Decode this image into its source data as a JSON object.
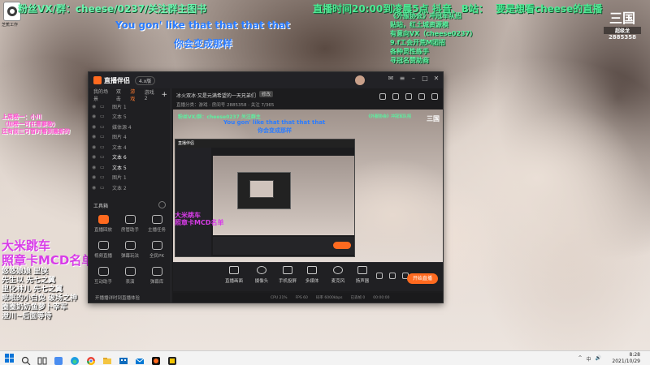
{
  "ticker": {
    "part1": "粉丝VX/群：cheese/0237/关注群主图书",
    "part2": "直播时间20:00到凌晨5点 抖音、B站：",
    "part3": "要是想看cheese的直播"
  },
  "app_badge": {
    "label": "芝蕉工作"
  },
  "lyrics": {
    "line1": "You gon' like that that that that",
    "line2": "你会变成那样"
  },
  "notice": [
    "《外服协会》冲冠军队招",
    "贴站，红土城资源模",
    "有意向VX（cheese0237）",
    "9.f工会开荒M团招",
    "各种灵性练手",
    "寻冠名赞助商"
  ],
  "brand_logo": {
    "big": "三国",
    "small": "超级龙",
    "number": "2885358"
  },
  "left_note": [
    "上周榜一：小川",
    "（加榜一可任意要歌）",
    "还有前三可暂时看到最新的"
  ],
  "big_title": [
    "大米跳车",
    "照章卡MCD名单"
  ],
  "gift_list": [
    "悠悠娘娘 里侠",
    "先生以 先七之翼",
    "里化林儿 先七之翼",
    "眠眠的小白兔 破场之神",
    "圈圈奶奶鱼萝卜宰军",
    "澄川~后面等待"
  ],
  "window": {
    "app_name": "直播伴侣",
    "version": "4.x版",
    "scene_tabs": [
      "我的场景",
      "双击",
      "游戏",
      "游戏2"
    ],
    "active_tab": "游戏",
    "sources": [
      {
        "label": "图片 1",
        "on": false
      },
      {
        "label": "文本 5",
        "on": false
      },
      {
        "label": "媒体源 4",
        "on": false
      },
      {
        "label": "图片 4",
        "on": false
      },
      {
        "label": "文本 4",
        "on": false
      },
      {
        "label": "文本 6",
        "on": true
      },
      {
        "label": "文本 5",
        "on": true
      },
      {
        "label": "图片 1",
        "on": false
      },
      {
        "label": "文本 2",
        "on": false
      }
    ],
    "tools_label": "工具箱",
    "tools": [
      {
        "label": "直播回放",
        "hot": true
      },
      {
        "label": "房管助手",
        "hot": false
      },
      {
        "label": "主播任务",
        "hot": false
      },
      {
        "label": "视频直播",
        "hot": false
      },
      {
        "label": "弹幕玩法",
        "hot": false
      },
      {
        "label": "全民PK",
        "hot": false
      },
      {
        "label": "互动助手",
        "hot": false
      },
      {
        "label": "表演",
        "hot": false
      },
      {
        "label": "弹幕库",
        "hot": false
      }
    ],
    "sidebar_bottom": "开播播详时到直播体验",
    "room_title": "冰火双冰·又是元满希望的一天兄弟们",
    "room_tag": "修改",
    "room_sub": "直播分类：游戏 · 房间号 2885358 · 关注 7/365",
    "controls": [
      {
        "label": "直播画面"
      },
      {
        "label": "摄像头"
      },
      {
        "label": "手机投屏"
      },
      {
        "label": "多媒体"
      },
      {
        "label": "麦克风"
      },
      {
        "label": "扬声器"
      }
    ],
    "start_label": "开始直播",
    "status": [
      "CPU 21%",
      "FPS 60",
      "码率 6000kbps",
      "已丢帧 0",
      "00:00:00"
    ]
  },
  "preview": {
    "ticker": "粉丝VX/群：cheese0237 关注群主",
    "lyric1": "You gon' like that that that that",
    "lyric2": "你会变成那样",
    "notice": "《外服协会》冲冠军队招",
    "logo": "三国",
    "big": "大米跳车\n照章卡MCD名单",
    "nested_title": "直播伴侣"
  },
  "taskbar": {
    "time": "8:28",
    "date": "2021/10/29",
    "tray": [
      "^",
      "中",
      "🔊"
    ]
  },
  "colors": {
    "accent": "#ff6a1f",
    "lyric_blue": "#2b7cff",
    "ticker_green": "#5cf0a0",
    "title_purple": "#d83ce8"
  }
}
